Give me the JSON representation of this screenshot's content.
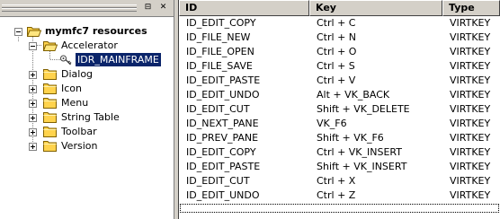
{
  "tree": {
    "root_label": "mymfc7 resources",
    "accelerator_label": "Accelerator",
    "selected_label": "IDR_MAINFRAME",
    "folders": [
      "Dialog",
      "Icon",
      "Menu",
      "String Table",
      "Toolbar",
      "Version"
    ]
  },
  "pane_buttons": {
    "pin": "⊟",
    "close": "✕"
  },
  "list": {
    "columns": [
      "ID",
      "Key",
      "Type"
    ],
    "rows": [
      {
        "id": "ID_EDIT_COPY",
        "key": "Ctrl + C",
        "type": "VIRTKEY"
      },
      {
        "id": "ID_FILE_NEW",
        "key": "Ctrl + N",
        "type": "VIRTKEY"
      },
      {
        "id": "ID_FILE_OPEN",
        "key": "Ctrl + O",
        "type": "VIRTKEY"
      },
      {
        "id": "ID_FILE_SAVE",
        "key": "Ctrl + S",
        "type": "VIRTKEY"
      },
      {
        "id": "ID_EDIT_PASTE",
        "key": "Ctrl + V",
        "type": "VIRTKEY"
      },
      {
        "id": "ID_EDIT_UNDO",
        "key": "Alt + VK_BACK",
        "type": "VIRTKEY"
      },
      {
        "id": "ID_EDIT_CUT",
        "key": "Shift + VK_DELETE",
        "type": "VIRTKEY"
      },
      {
        "id": "ID_NEXT_PANE",
        "key": "VK_F6",
        "type": "VIRTKEY"
      },
      {
        "id": "ID_PREV_PANE",
        "key": "Shift + VK_F6",
        "type": "VIRTKEY"
      },
      {
        "id": "ID_EDIT_COPY",
        "key": "Ctrl + VK_INSERT",
        "type": "VIRTKEY"
      },
      {
        "id": "ID_EDIT_PASTE",
        "key": "Shift + VK_INSERT",
        "type": "VIRTKEY"
      },
      {
        "id": "ID_EDIT_CUT",
        "key": "Ctrl + X",
        "type": "VIRTKEY"
      },
      {
        "id": "ID_EDIT_UNDO",
        "key": "Ctrl + Z",
        "type": "VIRTKEY"
      }
    ]
  },
  "colors": {
    "selection": "#0a246a",
    "chrome": "#d4d0c8",
    "folder": "#ffd34d"
  }
}
